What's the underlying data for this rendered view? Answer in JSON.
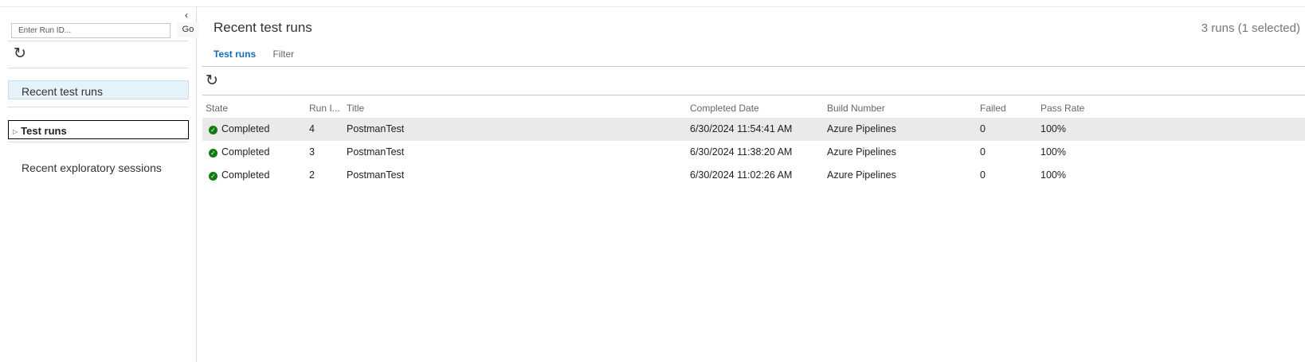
{
  "left_pane": {
    "collapse_icon": "chevron-left-icon",
    "run_id_placeholder": "Enter Run ID...",
    "go_label": "Go",
    "refresh_icon": "refresh-icon",
    "recent_test_runs": "Recent test runs",
    "test_runs": "Test runs",
    "recent_exploratory_sessions": "Recent exploratory sessions"
  },
  "main": {
    "title": "Recent test runs",
    "run_count": "3 runs (1 selected)",
    "tabs": [
      {
        "label": "Test runs",
        "active": true
      },
      {
        "label": "Filter",
        "active": false
      }
    ],
    "refresh_icon": "refresh-icon"
  },
  "grid": {
    "columns": [
      "State",
      "Run I...",
      "Title",
      "Completed Date",
      "Build Number",
      "Failed",
      "Pass Rate"
    ],
    "rows": [
      {
        "state": "Completed",
        "run_id": "4",
        "title": "PostmanTest",
        "completed": "6/30/2024 11:54:41 AM",
        "build": "Azure Pipelines",
        "failed": "0",
        "pass_rate": "100%",
        "selected": true
      },
      {
        "state": "Completed",
        "run_id": "3",
        "title": "PostmanTest",
        "completed": "6/30/2024 11:38:20 AM",
        "build": "Azure Pipelines",
        "failed": "0",
        "pass_rate": "100%",
        "selected": false
      },
      {
        "state": "Completed",
        "run_id": "2",
        "title": "PostmanTest",
        "completed": "6/30/2024 11:02:26 AM",
        "build": "Azure Pipelines",
        "failed": "0",
        "pass_rate": "100%",
        "selected": false
      }
    ],
    "state_icon": "success-check-icon"
  },
  "colors": {
    "accent": "#106ebe",
    "success": "#107c10",
    "selected_row": "#eaeaea",
    "nav_selected": "#e6f2fa"
  }
}
